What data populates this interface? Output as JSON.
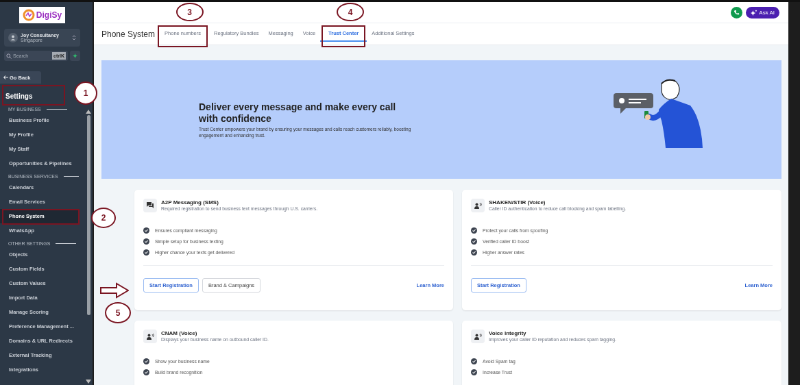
{
  "sidebar": {
    "logo": "DigiSy",
    "account": {
      "name": "Joy Consultancy",
      "location": "Singapore"
    },
    "search": {
      "placeholder": "Search",
      "shortcut": "ctrlK"
    },
    "back": "Go Back",
    "heading": {
      "label": "Settings",
      "highlighted": true,
      "callout": "1"
    },
    "sections": [
      {
        "title": "MY BUSINESS",
        "items": [
          {
            "label": "Business Profile",
            "selected": false,
            "highlighted": false
          },
          {
            "label": "My Profile",
            "selected": false,
            "highlighted": false
          },
          {
            "label": "My Staff",
            "selected": false,
            "highlighted": false
          },
          {
            "label": "Opportunities & Pipelines",
            "selected": false,
            "highlighted": false
          }
        ]
      },
      {
        "title": "BUSINESS SERVICES",
        "items": [
          {
            "label": "Calendars",
            "selected": false,
            "highlighted": false
          },
          {
            "label": "Email Services",
            "selected": false,
            "highlighted": false
          },
          {
            "label": "Phone System",
            "selected": true,
            "highlighted": true,
            "callout": "2"
          },
          {
            "label": "WhatsApp",
            "selected": false,
            "highlighted": false
          }
        ]
      },
      {
        "title": "OTHER SETTINGS",
        "items": [
          {
            "label": "Objects",
            "selected": false,
            "highlighted": false
          },
          {
            "label": "Custom Fields",
            "selected": false,
            "highlighted": false
          },
          {
            "label": "Custom Values",
            "selected": false,
            "highlighted": false
          },
          {
            "label": "Import Data",
            "selected": false,
            "highlighted": false
          },
          {
            "label": "Manage Scoring",
            "selected": false,
            "highlighted": false
          },
          {
            "label": "Preference Management ...",
            "selected": false,
            "highlighted": false
          },
          {
            "label": "Domains & URL Redirects",
            "selected": false,
            "highlighted": false
          },
          {
            "label": "External Tracking",
            "selected": false,
            "highlighted": false
          },
          {
            "label": "Integrations",
            "selected": false,
            "highlighted": false
          }
        ]
      }
    ]
  },
  "topbar": {
    "ask_ai": "Ask AI"
  },
  "page_title": "Phone System",
  "tabs": [
    {
      "label": "Phone numbers",
      "selected": false,
      "highlighted": true,
      "callout": "3"
    },
    {
      "label": "Regulatory Bundles",
      "selected": false,
      "highlighted": false
    },
    {
      "label": "Messaging",
      "selected": false,
      "highlighted": false
    },
    {
      "label": "Voice",
      "selected": false,
      "highlighted": false
    },
    {
      "label": "Trust Center",
      "selected": true,
      "highlighted": true,
      "callout": "4"
    },
    {
      "label": "Additional Settings",
      "selected": false,
      "highlighted": false
    }
  ],
  "hero": {
    "heading": "Deliver every message and make every call with confidence",
    "text": "Trust Center empowers your brand by ensuring your messages and calls reach customers reliably, boosting engagement and enhancing trust."
  },
  "cards": [
    {
      "kind": "chat",
      "title": "A2P Messaging (SMS)",
      "description": "Required registration to send business text messages through U.S. carriers.",
      "features": [
        "Ensures compliant messaging",
        "Simple setup for business texting",
        "Higher chance your texts get delivered"
      ],
      "buttons": [
        "Start Registration",
        "Brand & Campaigns"
      ],
      "link": "Learn More",
      "callout": "5",
      "callout_arrow": true
    },
    {
      "kind": "voice",
      "title": "SHAKEN/STIR (Voice)",
      "description": "Caller ID authentication to reduce call blocking and spam labelling.",
      "features": [
        "Protect your calls from spoofing",
        "Verified caller ID boost",
        "Higher answer rates"
      ],
      "buttons": [
        "Start Registration"
      ],
      "link": "Learn More"
    },
    {
      "kind": "voice",
      "title": "CNAM (Voice)",
      "description": "Displays your business name on outbound caller ID.",
      "features": [
        "Show your business name",
        "Build brand recognition"
      ]
    },
    {
      "kind": "voice",
      "title": "Voice Integrity",
      "description": "Improves your caller ID reputation and reduces spam tagging.",
      "features": [
        "Avoid Spam tag",
        "Increase Trust"
      ]
    }
  ]
}
